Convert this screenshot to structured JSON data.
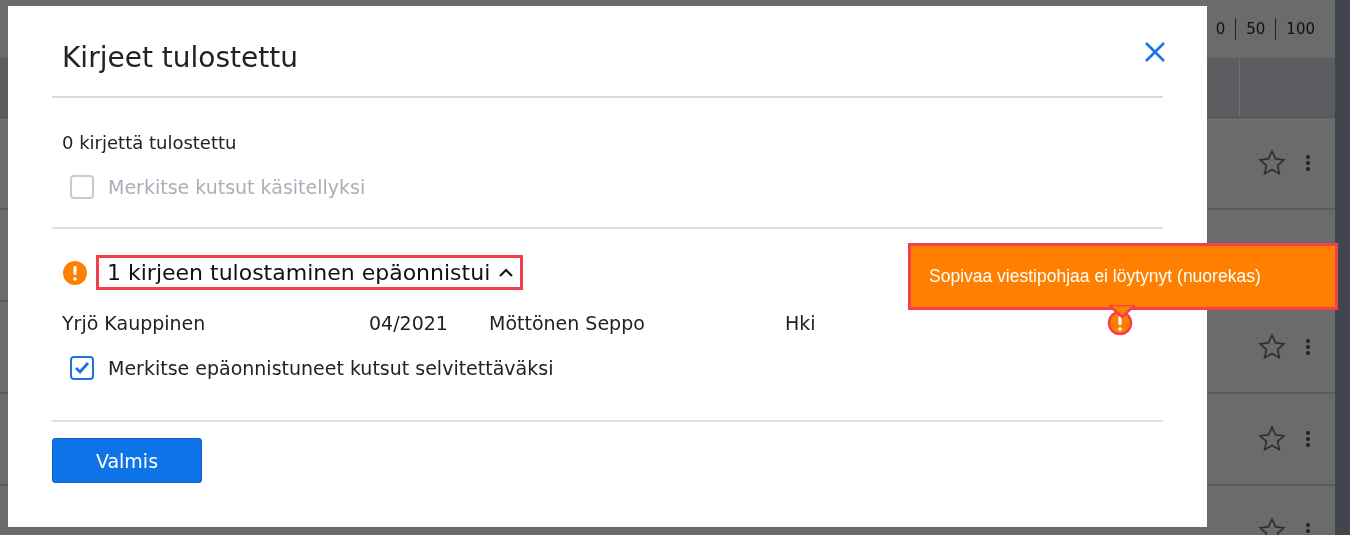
{
  "background": {
    "pager": [
      "0",
      "50",
      "100"
    ],
    "rows": [
      {
        "starred": false
      },
      {},
      {
        "starred": false
      },
      {
        "starred": false
      },
      {
        "starred": false
      }
    ]
  },
  "dialog": {
    "title": "Kirjeet tulostettu",
    "summary": "0 kirjettä tulostettu",
    "mark_processed": {
      "label": "Merkitse kutsut käsitellyksi",
      "checked": false,
      "disabled": true
    },
    "failure": {
      "heading": "1 kirjeen tulostaminen epäonnistui",
      "expanded": true,
      "rows": [
        {
          "cells": [
            "Yrjö Kauppinen",
            "04/2021",
            "Möttönen Seppo",
            "Hki"
          ],
          "tooltip": "Sopivaa viestipohjaa ei löytynyt (nuorekas)"
        }
      ],
      "mark_failed": {
        "label": "Merkitse epäonnistuneet kutsut selvitettäväksi",
        "checked": true,
        "disabled": false
      }
    },
    "button": "Valmis"
  }
}
